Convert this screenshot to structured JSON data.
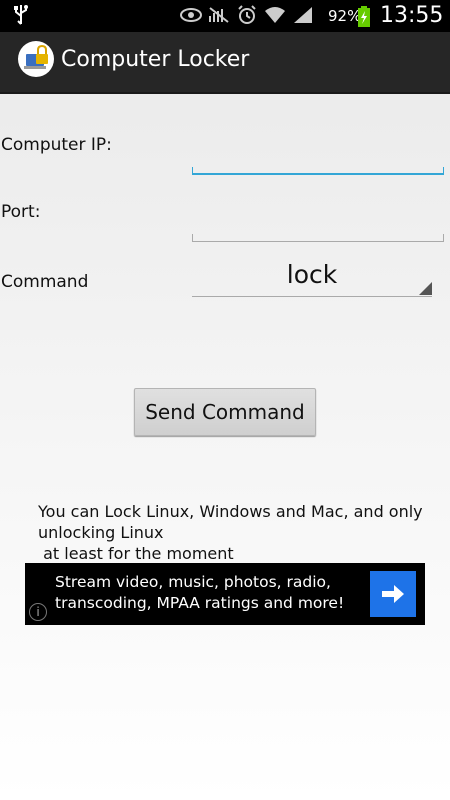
{
  "status_bar": {
    "battery_percent": "92%",
    "time": "13:55",
    "icons": [
      "usb-icon",
      "eye-icon",
      "mute-icon",
      "alarm-icon",
      "wifi-icon",
      "signal-icon",
      "battery-charging-icon"
    ]
  },
  "action_bar": {
    "title": "Computer Locker",
    "icon": "lock-laptop-icon"
  },
  "form": {
    "ip_label": "Computer IP:",
    "ip_value": "",
    "port_label": "Port:",
    "port_value": "",
    "command_label": "Command",
    "command_value": "lock"
  },
  "send_button": {
    "label": "Send Command"
  },
  "info_text": {
    "line1": "You can Lock Linux, Windows and Mac, and only unlocking Linux",
    "line2": " at least for the moment"
  },
  "ad": {
    "text": "Stream video, music, photos, radio, transcoding, MPAA ratings and more!",
    "arrow_color": "#1e73e8",
    "info_glyph": "i"
  }
}
